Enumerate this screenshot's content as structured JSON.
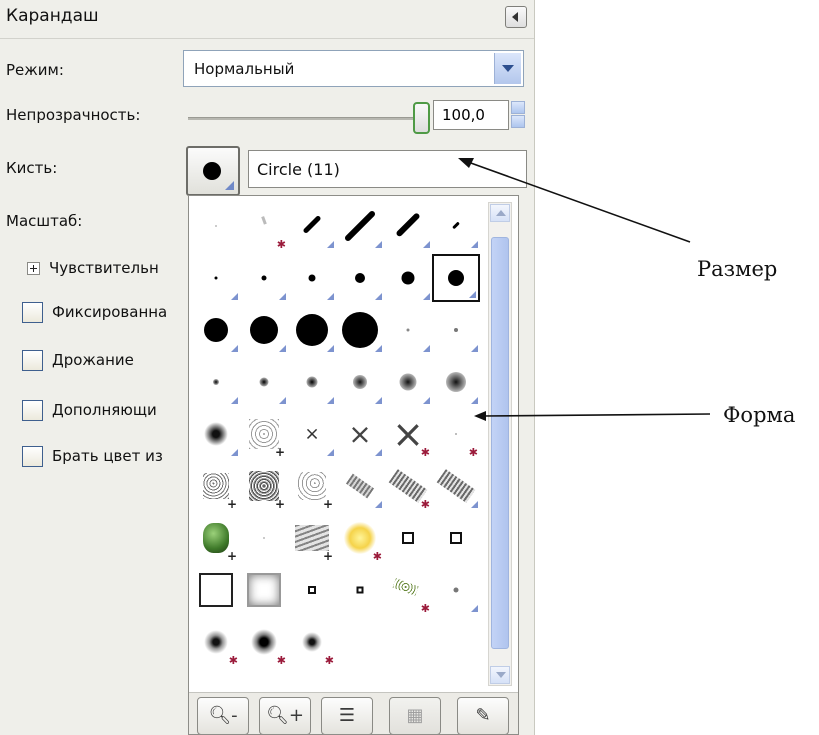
{
  "panel": {
    "title": "Карандаш",
    "mode": {
      "label": "Режим:",
      "value": "Нормальный"
    },
    "opacity": {
      "label": "Непрозрачность:",
      "value": "100,0",
      "fraction": 1.0
    },
    "brush": {
      "label": "Кисть:",
      "name": "Circle (11)"
    },
    "scale": {
      "label": "Масштаб:"
    },
    "sensitivity": {
      "label": "Чувствительн"
    },
    "options": [
      {
        "label": "Фиксированна",
        "checked": false
      },
      {
        "label": "Дрожание",
        "checked": false
      },
      {
        "label": "Дополняющи",
        "checked": false
      },
      {
        "label": "Брать цвет из",
        "checked": false
      }
    ]
  },
  "brush_popup": {
    "toolbar": [
      {
        "icon": "zoom-out-icon",
        "glyph": "🔍︎-"
      },
      {
        "icon": "zoom-in-icon",
        "glyph": "🔍︎+"
      },
      {
        "icon": "list-view-icon",
        "glyph": "☰"
      },
      {
        "icon": "grid-view-icon",
        "glyph": "▦"
      },
      {
        "icon": "edit-brush-icon",
        "glyph": "✎"
      }
    ]
  },
  "annotations": {
    "size": "Размер",
    "shape": "Форма"
  }
}
